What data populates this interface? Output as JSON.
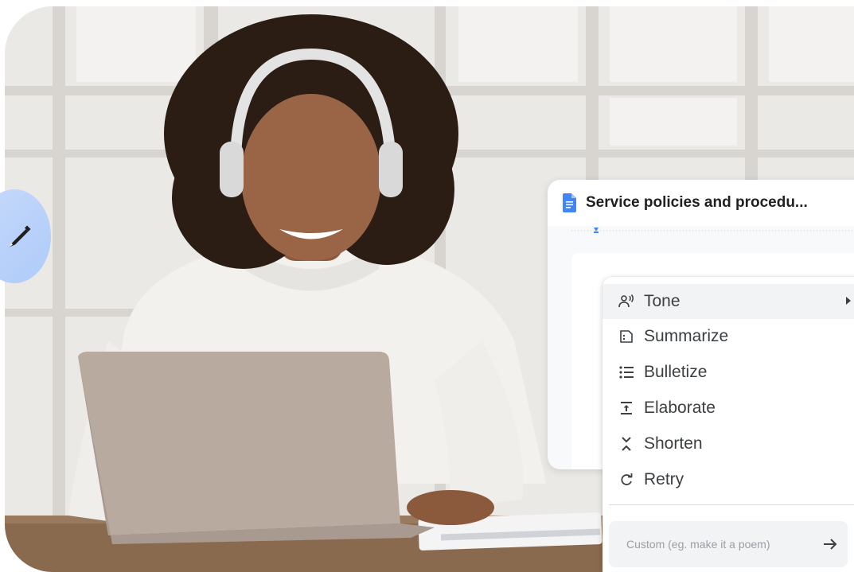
{
  "document": {
    "title": "Service policies and procedu...",
    "icon": "google-docs-icon"
  },
  "menu": {
    "items": [
      {
        "label": "Tone",
        "icon": "tone-voice-icon",
        "has_submenu": true
      },
      {
        "label": "Summarize",
        "icon": "summarize-icon"
      },
      {
        "label": "Bulletize",
        "icon": "bulleted-list-icon"
      },
      {
        "label": "Elaborate",
        "icon": "expand-vertical-icon"
      },
      {
        "label": "Shorten",
        "icon": "collapse-vertical-icon"
      },
      {
        "label": "Retry",
        "icon": "retry-icon"
      }
    ],
    "custom_placeholder": "Custom (eg. make it a poem)"
  },
  "fab": {
    "icon": "pen-icon"
  },
  "colors": {
    "docs_blue": "#4285f4",
    "fab_blue": "#aecbf9",
    "text": "#3c4043"
  }
}
